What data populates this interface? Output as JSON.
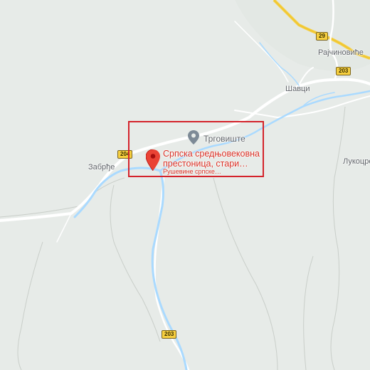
{
  "map": {
    "places": [
      {
        "name": "Рајчиновиће"
      },
      {
        "name": "Шавци"
      },
      {
        "name": "Забрђе"
      },
      {
        "name": "Лукоцре"
      }
    ],
    "poi": {
      "name": "Трговиште",
      "icon": "grey-location-pin-icon"
    },
    "selected_place": {
      "title": "Српска средњовековна престоница, стари…",
      "subtitle": "Рушевине српске…",
      "icon": "red-location-pin-icon",
      "color": "#d93025"
    },
    "road_shields": [
      {
        "number": "29"
      },
      {
        "number": "203"
      },
      {
        "number": "204"
      },
      {
        "number": "203"
      }
    ],
    "colors": {
      "background": "#e7ebe8",
      "road": "#ffffff",
      "river": "#aadaff",
      "highway": "#f6cf3f",
      "highlight_box": "#d4232b"
    }
  }
}
